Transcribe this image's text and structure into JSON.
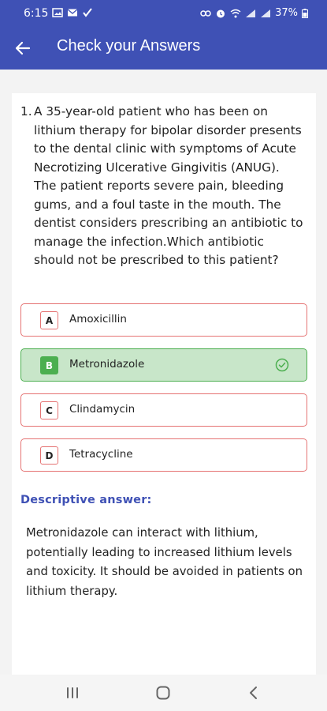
{
  "status_bar": {
    "time": "6:15",
    "battery": "37%"
  },
  "app_bar": {
    "title": "Check your Answers"
  },
  "question": {
    "number": "1.",
    "text": "A 35-year-old patient who has been on lithium therapy for bipolar disorder presents to the dental clinic with symptoms of Acute Necrotizing Ulcerative Gingivitis (ANUG). The patient reports severe pain, bleeding gums, and a foul taste in the mouth. The dentist considers prescribing an antibiotic to manage the infection.Which antibiotic should not be prescribed to this patient?"
  },
  "options": [
    {
      "letter": "A",
      "label": "Amoxicillin"
    },
    {
      "letter": "B",
      "label": "Metronidazole"
    },
    {
      "letter": "C",
      "label": "Clindamycin"
    },
    {
      "letter": "D",
      "label": "Tetracycline"
    }
  ],
  "correct_option": "B",
  "descriptive": {
    "title": "Descriptive answer:",
    "text": "Metronidazole can interact with lithium, potentially leading to increased lithium levels and toxicity. It should be avoided in patients on lithium therapy."
  },
  "colors": {
    "primary": "#3f51b5",
    "correct_bg": "#c8e6c9",
    "correct_border": "#4caf50",
    "wrong_border": "#e57373"
  },
  "icons": {
    "back": "arrow-left-icon",
    "correct": "check-circle-icon",
    "nav_recents": "recents-icon",
    "nav_home": "home-icon",
    "nav_back": "back-chevron-icon"
  }
}
